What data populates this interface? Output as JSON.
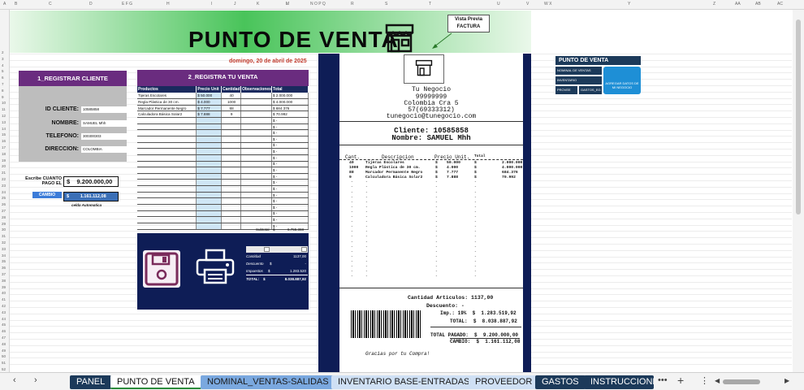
{
  "columns": [
    "A",
    "B",
    "C",
    "D",
    "E F G",
    "H",
    "I",
    "J",
    "K",
    "L",
    "M",
    "N O P Q",
    "R",
    "S",
    "T",
    "U",
    "V",
    "W X",
    "Y",
    "Z",
    "AA",
    "AB",
    "AC"
  ],
  "rows": [
    "2",
    "3",
    "4",
    "5",
    "6",
    "7",
    "8",
    "9",
    "10",
    "11",
    "12",
    "13",
    "14",
    "15",
    "16",
    "17",
    "18",
    "19",
    "20",
    "21",
    "22",
    "23",
    "24",
    "25",
    "26",
    "27",
    "28",
    "29",
    "30",
    "31",
    "32",
    "33",
    "34",
    "35",
    "36",
    "37",
    "38",
    "39",
    "40",
    "41",
    "42",
    "43",
    "44",
    "45",
    "46",
    "47",
    "48",
    "49",
    "50",
    "51",
    "52"
  ],
  "banner": {
    "title": "PUNTO DE VENTA",
    "store_icon": "store-icon",
    "preview_label": "Vista Previa FACTURA"
  },
  "date": "domingo, 20 de abril de 2025",
  "client": {
    "header": "1_REGISTRAR CLIENTE",
    "id_label": "ID CLIENTE:",
    "id_value": "10585858",
    "name_label": "NOMBRE:",
    "name_value": "SAMUEL Mhh",
    "phone_label": "TELEFONO:",
    "phone_value": "300300303",
    "address_label": "DIRECCION:",
    "address_value": "COLOMBIA"
  },
  "payment": {
    "label": "Escribe CUANTO PAGO EL",
    "currency": "$",
    "value": "9.200.000,00",
    "cambio_label": "CAMBIO",
    "cambio_value": "1.161.112,08",
    "celda_note": "celda Automatica"
  },
  "sale": {
    "header": "2_REGISTRA TU VENTA",
    "columns": [
      "Productos",
      "Precio Unit",
      "Cantidad",
      "Observaciones",
      "Total"
    ],
    "rows": [
      {
        "product": "Tijeras Escolares",
        "cur": "$",
        "price": "50.000",
        "qty": "40",
        "obs": "",
        "tcur": "$",
        "total": "2.000.000"
      },
      {
        "product": "Regla Plástica de 30 cm.",
        "cur": "$",
        "price": "4.000",
        "qty": "1000",
        "obs": "",
        "tcur": "$",
        "total": "4.000.000"
      },
      {
        "product": "Marcador Permanente Negro",
        "cur": "$",
        "price": "7.777",
        "qty": "88",
        "obs": "",
        "tcur": "$",
        "total": "684.376"
      },
      {
        "product": "Calculadora Básica Solar2",
        "cur": "$",
        "price": "7.888",
        "qty": "9",
        "obs": "",
        "tcur": "$",
        "total": "70.992"
      }
    ],
    "empty_cur": "$",
    "empty_dash": "-",
    "subtotal_label": "Subtotal",
    "subtotal_cur": "$",
    "subtotal_value": "6.755.368",
    "stats": {
      "cantidad_label": "Cantidad",
      "cantidad_value": "1137,00",
      "descuento_label": "Descuento",
      "descuento_cur": "$",
      "descuento_value": "-",
      "impuestos_label": "Impuestos",
      "impuestos_cur": "$",
      "impuestos_value": "1.283.520",
      "total_label": "TOTAL:",
      "total_cur": "$",
      "total_value": "8.038.887,92"
    }
  },
  "receipt": {
    "business": "Tu Negocio",
    "phone_code": "99999999",
    "address": "Colombia Cra 5",
    "phone": "57(69333312)",
    "email": "tunegocio@tunegocio.com",
    "client": "Cliente: 10585858",
    "name": "Nombre: SAMUEL Mhh",
    "col_cant": "Cant.",
    "col_desc": "Descripcion",
    "col_price": "Precio Unit.",
    "col_total": "Total",
    "items": [
      {
        "qty": "40",
        "desc": "Tijeras Escolares",
        "cur": "$",
        "price": "50.000",
        "tcur": "$",
        "total": "2.000.000"
      },
      {
        "qty": "1000",
        "desc": "Regla Plástica de 30 cm.",
        "cur": "$",
        "price": "4.000",
        "tcur": "$",
        "total": "4.000.000"
      },
      {
        "qty": "88",
        "desc": "Marcador Permanente Negro",
        "cur": "$",
        "price": "7.777",
        "tcur": "$",
        "total": "684.376"
      },
      {
        "qty": "9",
        "desc": "Calculadora Básica Solar2",
        "cur": "$",
        "price": "7.888",
        "tcur": "$",
        "total": "70.992"
      }
    ],
    "dash": "-",
    "cantidad_label": "Cantidad Articulos:",
    "cantidad_value": "1137,00",
    "descuento_label": "Descuento:",
    "descuento_value": "-",
    "imp_label": "Imp.: 19%",
    "imp_cur": "$",
    "imp_value": "1.283.519,92",
    "total_label": "TOTAL:",
    "total_cur": "$",
    "total_value": "8.038.887,92",
    "pagado_label": "TOTAL PAGADO:",
    "pagado_cur": "$",
    "pagado_value": "9.200.000,00",
    "cambio_label": "CAMBIO:",
    "cambio_cur": "$",
    "cambio_value": "1.161.112,08",
    "thanks": "Gracias por tu Compra!"
  },
  "right_panel": {
    "title": "PUNTO DE VENTA",
    "nominal": "NOMINAL DE VENTAS",
    "inventario": "INVENTARIO",
    "proveedor": "PROVEE",
    "gastos": "GASTOS_EG",
    "agregar": "AGREGAR DATOS DE MI NEGOCIO"
  },
  "tabs": [
    "PANEL",
    "PUNTO DE VENTA",
    "NOMINAL_VENTAS-SALIDAS",
    "INVENTARIO BASE-ENTRADAS",
    "PROVEEDOR",
    "GASTOS",
    "INSTRUCCIONES"
  ],
  "tab_more": "•••",
  "tab_add": "+",
  "tab_menu": "⋮",
  "tab_prev": "‹",
  "tab_next": "›",
  "colors": {
    "accent_purple": "#6a2c7f",
    "navy": "#0e1d56",
    "green": "#49c45a",
    "price_blue": "#cfe6f5"
  }
}
